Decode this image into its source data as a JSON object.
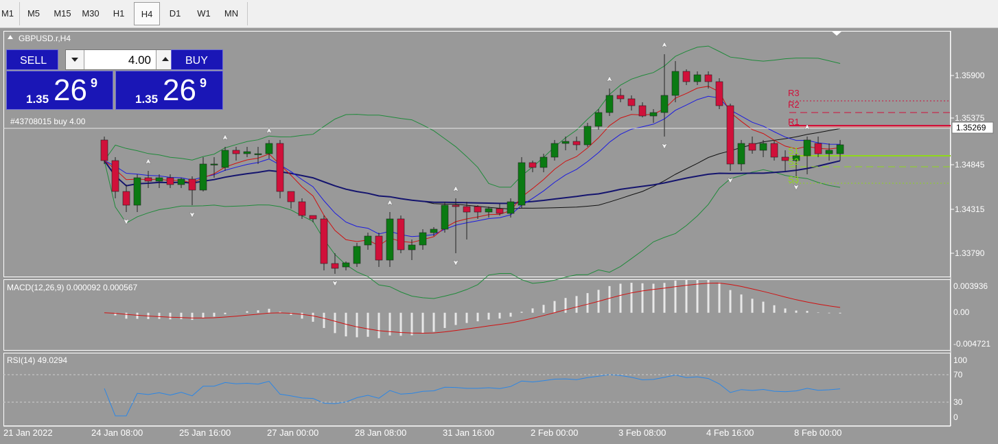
{
  "timeframes": [
    "M1",
    "M5",
    "M15",
    "M30",
    "H1",
    "H4",
    "D1",
    "W1",
    "MN"
  ],
  "active_timeframe": "H4",
  "symbol_title": "GBPUSD.r,H4",
  "trade_panel": {
    "sell_label": "SELL",
    "buy_label": "BUY",
    "lot": "4.00",
    "sell_price": {
      "big": "1.35",
      "main": "26",
      "sup": "9"
    },
    "buy_price": {
      "big": "1.35",
      "main": "26",
      "sup": "9"
    }
  },
  "order_label": "#43708015 buy 4.00",
  "current_price": "1.35269",
  "price_ticks": [
    "1.35900",
    "1.35375",
    "1.34845",
    "1.34315",
    "1.33790"
  ],
  "pivot_labels": [
    "R3",
    "R2",
    "R1",
    "S1",
    "S2",
    "S3"
  ],
  "macd": {
    "label": "MACD(12,26,9) 0.000092 0.000567",
    "ticks": [
      "0.003936",
      "0.00",
      "-0.004721"
    ]
  },
  "rsi": {
    "label": "RSI(14) 49.0294",
    "ticks": [
      "100",
      "70",
      "30",
      "0"
    ]
  },
  "time_labels": [
    "21 Jan 2022",
    "24 Jan 08:00",
    "25 Jan 16:00",
    "27 Jan 00:00",
    "28 Jan 08:00",
    "31 Jan 16:00",
    "2 Feb 00:00",
    "3 Feb 08:00",
    "4 Feb 16:00",
    "8 Feb 00:00"
  ],
  "colors": {
    "bull": "#0a7a12",
    "bear": "#d0103a",
    "bg": "#999999",
    "ma_navy": "#14146e",
    "ma_blue": "#1a1ae0",
    "ma_red": "#d01010",
    "bands": "#1f8a3a",
    "support": "#8fd81a",
    "resistance": "#d0103a"
  },
  "chart_data": {
    "type": "candlestick",
    "symbol": "GBPUSD.r",
    "timeframe": "H4",
    "ohlc": [
      [
        1.3525,
        1.353,
        1.349,
        1.3495
      ],
      [
        1.3495,
        1.35,
        1.344,
        1.345
      ],
      [
        1.345,
        1.346,
        1.342,
        1.343
      ],
      [
        1.343,
        1.3475,
        1.342,
        1.347
      ],
      [
        1.347,
        1.348,
        1.3455,
        1.3465
      ],
      [
        1.3465,
        1.3475,
        1.3455,
        1.347
      ],
      [
        1.347,
        1.3475,
        1.3455,
        1.346
      ],
      [
        1.346,
        1.347,
        1.3455,
        1.3468
      ],
      [
        1.3468,
        1.3472,
        1.343,
        1.3452
      ],
      [
        1.3452,
        1.35,
        1.345,
        1.349
      ],
      [
        1.349,
        1.35,
        1.347,
        1.349
      ],
      [
        1.3485,
        1.3515,
        1.348,
        1.351
      ],
      [
        1.351,
        1.3515,
        1.3495,
        1.3505
      ],
      [
        1.3505,
        1.3515,
        1.35,
        1.3508
      ],
      [
        1.3505,
        1.3515,
        1.349,
        1.3505
      ],
      [
        1.3505,
        1.3525,
        1.3498,
        1.352
      ],
      [
        1.352,
        1.3525,
        1.344,
        1.345
      ],
      [
        1.345,
        1.345,
        1.3425,
        1.3435
      ],
      [
        1.3435,
        1.344,
        1.341,
        1.3415
      ],
      [
        1.3415,
        1.3415,
        1.3405,
        1.341
      ],
      [
        1.341,
        1.3415,
        1.3335,
        1.3345
      ],
      [
        1.3345,
        1.336,
        1.333,
        1.3338
      ],
      [
        1.334,
        1.3348,
        1.3335,
        1.3346
      ],
      [
        1.3345,
        1.3375,
        1.334,
        1.337
      ],
      [
        1.3372,
        1.339,
        1.3365,
        1.3385
      ],
      [
        1.3385,
        1.339,
        1.334,
        1.335
      ],
      [
        1.335,
        1.342,
        1.334,
        1.341
      ],
      [
        1.341,
        1.3415,
        1.336,
        1.3365
      ],
      [
        1.3365,
        1.338,
        1.335,
        1.3372
      ],
      [
        1.3372,
        1.3395,
        1.3365,
        1.339
      ],
      [
        1.339,
        1.3398,
        1.3385,
        1.3395
      ],
      [
        1.3395,
        1.3435,
        1.339,
        1.343
      ],
      [
        1.343,
        1.344,
        1.336,
        1.3428
      ],
      [
        1.3428,
        1.3435,
        1.338,
        1.342
      ],
      [
        1.3428,
        1.343,
        1.341,
        1.342
      ],
      [
        1.342,
        1.3428,
        1.3412,
        1.3425
      ],
      [
        1.3425,
        1.3432,
        1.3415,
        1.3418
      ],
      [
        1.3418,
        1.344,
        1.3412,
        1.3435
      ],
      [
        1.343,
        1.35,
        1.3425,
        1.3492
      ],
      [
        1.3492,
        1.3495,
        1.3478,
        1.3485
      ],
      [
        1.3485,
        1.3505,
        1.3478,
        1.35
      ],
      [
        1.35,
        1.3525,
        1.3495,
        1.352
      ],
      [
        1.352,
        1.353,
        1.351,
        1.3523
      ],
      [
        1.3523,
        1.353,
        1.351,
        1.3518
      ],
      [
        1.3518,
        1.355,
        1.3515,
        1.3545
      ],
      [
        1.3545,
        1.357,
        1.354,
        1.3565
      ],
      [
        1.3565,
        1.36,
        1.356,
        1.359
      ],
      [
        1.359,
        1.36,
        1.358,
        1.3585
      ],
      [
        1.3585,
        1.359,
        1.3568,
        1.3575
      ],
      [
        1.3575,
        1.358,
        1.3558,
        1.356
      ],
      [
        1.356,
        1.357,
        1.355,
        1.3565
      ],
      [
        1.3565,
        1.365,
        1.353,
        1.359
      ],
      [
        1.359,
        1.364,
        1.358,
        1.3625
      ],
      [
        1.3625,
        1.3628,
        1.3605,
        1.361
      ],
      [
        1.361,
        1.3625,
        1.3605,
        1.362
      ],
      [
        1.362,
        1.3625,
        1.36,
        1.361
      ],
      [
        1.361,
        1.3615,
        1.357,
        1.3575
      ],
      [
        1.3575,
        1.3578,
        1.348,
        1.349
      ],
      [
        1.349,
        1.3525,
        1.348,
        1.352
      ],
      [
        1.352,
        1.353,
        1.3505,
        1.351
      ],
      [
        1.351,
        1.3525,
        1.35,
        1.352
      ],
      [
        1.352,
        1.3525,
        1.3495,
        1.35
      ],
      [
        1.35,
        1.351,
        1.348,
        1.3495
      ],
      [
        1.3495,
        1.3505,
        1.347,
        1.3502
      ],
      [
        1.3502,
        1.353,
        1.3475,
        1.3525
      ],
      [
        1.352,
        1.353,
        1.35,
        1.3505
      ],
      [
        1.3505,
        1.352,
        1.3495,
        1.351
      ],
      [
        1.3505,
        1.3525,
        1.3495,
        1.3518
      ]
    ],
    "y_range": [
      1.333,
      1.368
    ],
    "pivots": {
      "R3": 1.3582,
      "R2": 1.3565,
      "R1": 1.3546,
      "S1": 1.3502,
      "S2": 1.3486,
      "S3": 1.3462
    },
    "macd_range": [
      -0.004721,
      0.003936
    ],
    "rsi_range": [
      0,
      100
    ],
    "rsi_levels": [
      70,
      30
    ]
  }
}
